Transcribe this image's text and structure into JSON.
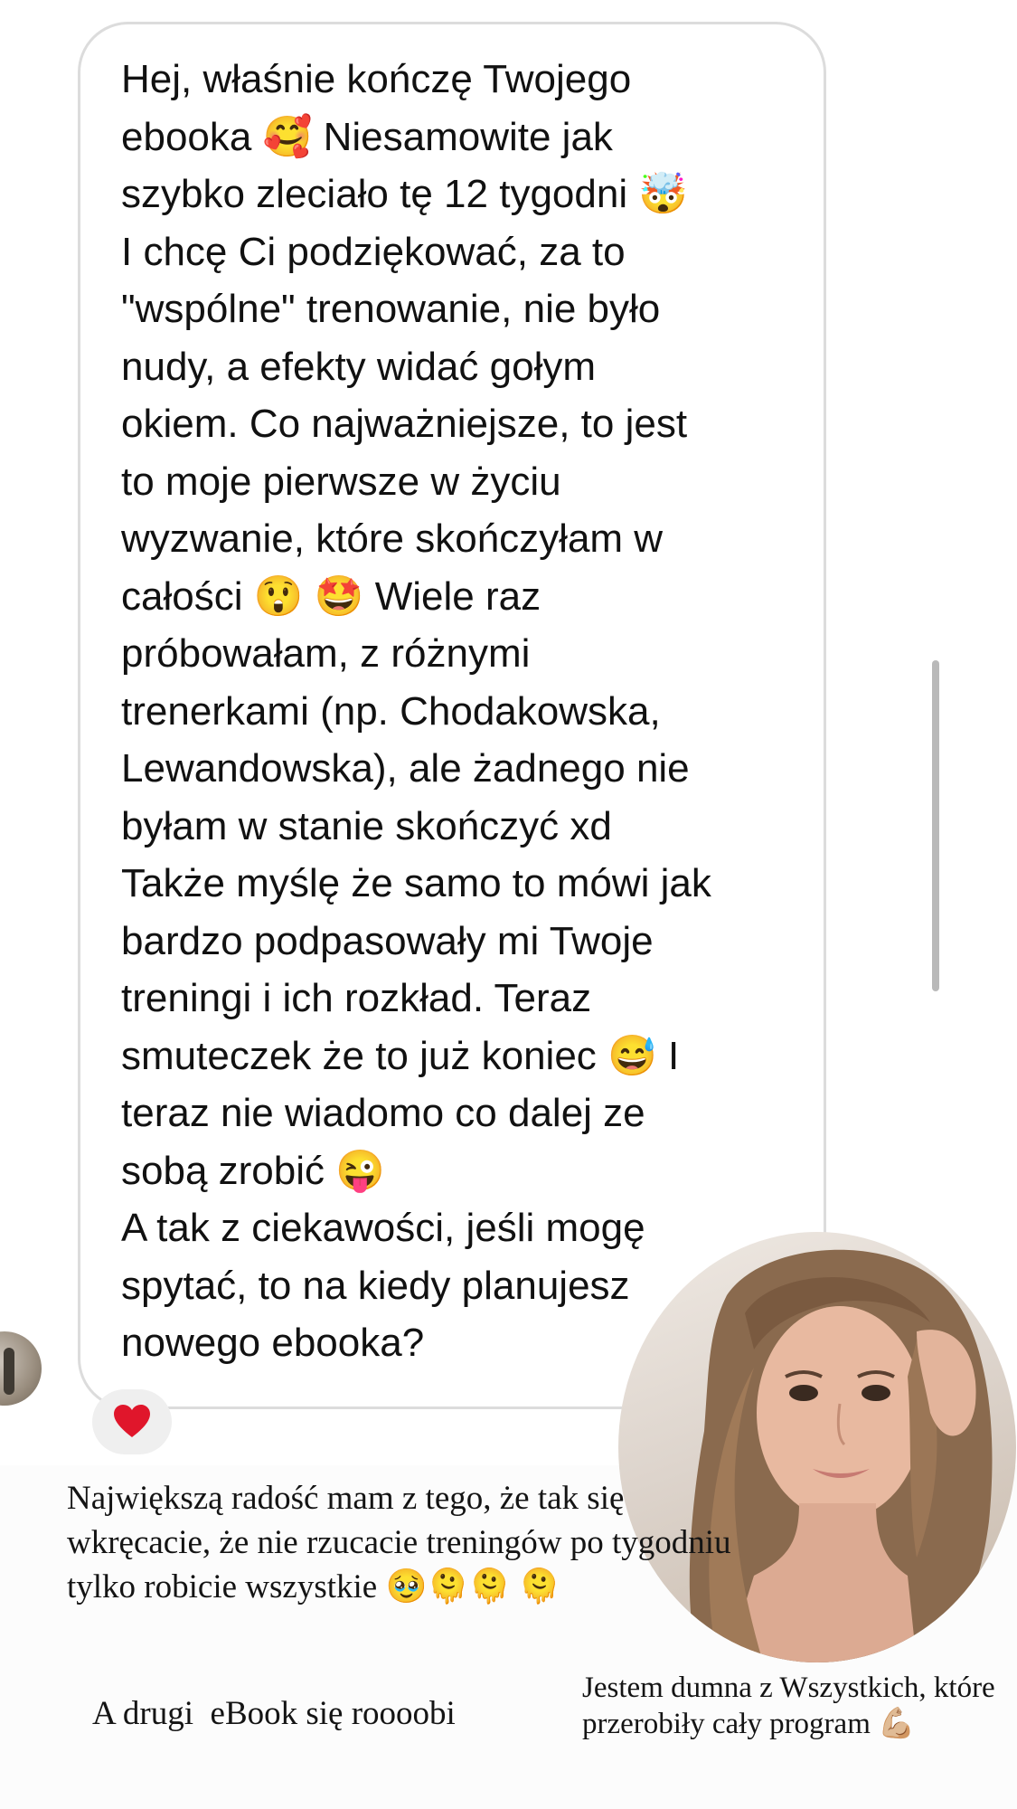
{
  "message": {
    "text": "Hej, właśnie kończę Twojego\nebooka 🥰 Niesamowite jak\nszybko zleciało tę 12 tygodni 🤯\nI chcę Ci podziękować, za to\n\"wspólne\" trenowanie, nie było\nnudy, a efekty widać gołym\nokiem. Co najważniejsze, to jest\nto moje pierwsze w życiu\nwyzwanie, które skończyłam w\ncałości 😲 🤩 Wiele raz\npróbowałam, z różnymi\ntrenerkami (np. Chodakowska,\nLewandowska), ale żadnego nie\nbyłam w stanie skończyć xd\nTakże myślę że samo to mówi jak\nbardzo podpasowały mi Twoje\ntreningi i ich rozkład. Teraz\nsmuteczek że to już koniec 😅 I\nteraz nie wiadomo co dalej ze\nsobą zrobić 😜\nA tak z ciekawości, jeśli mogę\nspytać, to na kiedy planujesz\nnowego ebooka?",
    "reaction_icon": "heart"
  },
  "captions": {
    "main": "Największą radość mam z tego, że tak się wkręcacie, że nie rzucacie treningów po tygodniu tylko robicie wszystkie 🥹🫠🫠 🫠",
    "second": "A drugi  eBook się roooobi",
    "third": "Jestem dumna z Wszystkich, które przerobiły cały program 💪🏼"
  },
  "colors": {
    "bubble_border": "#dcdcdc",
    "reaction_bg": "#efefef",
    "heart": "#e0162b",
    "scrollbar": "#b9b9b9"
  }
}
